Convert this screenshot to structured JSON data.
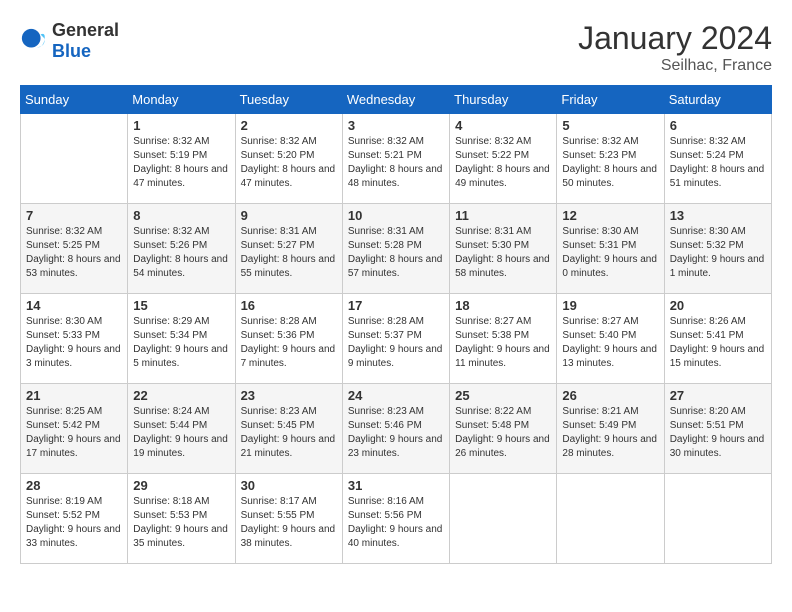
{
  "header": {
    "logo_general": "General",
    "logo_blue": "Blue",
    "month": "January 2024",
    "location": "Seilhac, France"
  },
  "days_of_week": [
    "Sunday",
    "Monday",
    "Tuesday",
    "Wednesday",
    "Thursday",
    "Friday",
    "Saturday"
  ],
  "weeks": [
    [
      {
        "day": "",
        "sunrise": "",
        "sunset": "",
        "daylight": ""
      },
      {
        "day": "1",
        "sunrise": "Sunrise: 8:32 AM",
        "sunset": "Sunset: 5:19 PM",
        "daylight": "Daylight: 8 hours and 47 minutes."
      },
      {
        "day": "2",
        "sunrise": "Sunrise: 8:32 AM",
        "sunset": "Sunset: 5:20 PM",
        "daylight": "Daylight: 8 hours and 47 minutes."
      },
      {
        "day": "3",
        "sunrise": "Sunrise: 8:32 AM",
        "sunset": "Sunset: 5:21 PM",
        "daylight": "Daylight: 8 hours and 48 minutes."
      },
      {
        "day": "4",
        "sunrise": "Sunrise: 8:32 AM",
        "sunset": "Sunset: 5:22 PM",
        "daylight": "Daylight: 8 hours and 49 minutes."
      },
      {
        "day": "5",
        "sunrise": "Sunrise: 8:32 AM",
        "sunset": "Sunset: 5:23 PM",
        "daylight": "Daylight: 8 hours and 50 minutes."
      },
      {
        "day": "6",
        "sunrise": "Sunrise: 8:32 AM",
        "sunset": "Sunset: 5:24 PM",
        "daylight": "Daylight: 8 hours and 51 minutes."
      }
    ],
    [
      {
        "day": "7",
        "sunrise": "Sunrise: 8:32 AM",
        "sunset": "Sunset: 5:25 PM",
        "daylight": "Daylight: 8 hours and 53 minutes."
      },
      {
        "day": "8",
        "sunrise": "Sunrise: 8:32 AM",
        "sunset": "Sunset: 5:26 PM",
        "daylight": "Daylight: 8 hours and 54 minutes."
      },
      {
        "day": "9",
        "sunrise": "Sunrise: 8:31 AM",
        "sunset": "Sunset: 5:27 PM",
        "daylight": "Daylight: 8 hours and 55 minutes."
      },
      {
        "day": "10",
        "sunrise": "Sunrise: 8:31 AM",
        "sunset": "Sunset: 5:28 PM",
        "daylight": "Daylight: 8 hours and 57 minutes."
      },
      {
        "day": "11",
        "sunrise": "Sunrise: 8:31 AM",
        "sunset": "Sunset: 5:30 PM",
        "daylight": "Daylight: 8 hours and 58 minutes."
      },
      {
        "day": "12",
        "sunrise": "Sunrise: 8:30 AM",
        "sunset": "Sunset: 5:31 PM",
        "daylight": "Daylight: 9 hours and 0 minutes."
      },
      {
        "day": "13",
        "sunrise": "Sunrise: 8:30 AM",
        "sunset": "Sunset: 5:32 PM",
        "daylight": "Daylight: 9 hours and 1 minute."
      }
    ],
    [
      {
        "day": "14",
        "sunrise": "Sunrise: 8:30 AM",
        "sunset": "Sunset: 5:33 PM",
        "daylight": "Daylight: 9 hours and 3 minutes."
      },
      {
        "day": "15",
        "sunrise": "Sunrise: 8:29 AM",
        "sunset": "Sunset: 5:34 PM",
        "daylight": "Daylight: 9 hours and 5 minutes."
      },
      {
        "day": "16",
        "sunrise": "Sunrise: 8:28 AM",
        "sunset": "Sunset: 5:36 PM",
        "daylight": "Daylight: 9 hours and 7 minutes."
      },
      {
        "day": "17",
        "sunrise": "Sunrise: 8:28 AM",
        "sunset": "Sunset: 5:37 PM",
        "daylight": "Daylight: 9 hours and 9 minutes."
      },
      {
        "day": "18",
        "sunrise": "Sunrise: 8:27 AM",
        "sunset": "Sunset: 5:38 PM",
        "daylight": "Daylight: 9 hours and 11 minutes."
      },
      {
        "day": "19",
        "sunrise": "Sunrise: 8:27 AM",
        "sunset": "Sunset: 5:40 PM",
        "daylight": "Daylight: 9 hours and 13 minutes."
      },
      {
        "day": "20",
        "sunrise": "Sunrise: 8:26 AM",
        "sunset": "Sunset: 5:41 PM",
        "daylight": "Daylight: 9 hours and 15 minutes."
      }
    ],
    [
      {
        "day": "21",
        "sunrise": "Sunrise: 8:25 AM",
        "sunset": "Sunset: 5:42 PM",
        "daylight": "Daylight: 9 hours and 17 minutes."
      },
      {
        "day": "22",
        "sunrise": "Sunrise: 8:24 AM",
        "sunset": "Sunset: 5:44 PM",
        "daylight": "Daylight: 9 hours and 19 minutes."
      },
      {
        "day": "23",
        "sunrise": "Sunrise: 8:23 AM",
        "sunset": "Sunset: 5:45 PM",
        "daylight": "Daylight: 9 hours and 21 minutes."
      },
      {
        "day": "24",
        "sunrise": "Sunrise: 8:23 AM",
        "sunset": "Sunset: 5:46 PM",
        "daylight": "Daylight: 9 hours and 23 minutes."
      },
      {
        "day": "25",
        "sunrise": "Sunrise: 8:22 AM",
        "sunset": "Sunset: 5:48 PM",
        "daylight": "Daylight: 9 hours and 26 minutes."
      },
      {
        "day": "26",
        "sunrise": "Sunrise: 8:21 AM",
        "sunset": "Sunset: 5:49 PM",
        "daylight": "Daylight: 9 hours and 28 minutes."
      },
      {
        "day": "27",
        "sunrise": "Sunrise: 8:20 AM",
        "sunset": "Sunset: 5:51 PM",
        "daylight": "Daylight: 9 hours and 30 minutes."
      }
    ],
    [
      {
        "day": "28",
        "sunrise": "Sunrise: 8:19 AM",
        "sunset": "Sunset: 5:52 PM",
        "daylight": "Daylight: 9 hours and 33 minutes."
      },
      {
        "day": "29",
        "sunrise": "Sunrise: 8:18 AM",
        "sunset": "Sunset: 5:53 PM",
        "daylight": "Daylight: 9 hours and 35 minutes."
      },
      {
        "day": "30",
        "sunrise": "Sunrise: 8:17 AM",
        "sunset": "Sunset: 5:55 PM",
        "daylight": "Daylight: 9 hours and 38 minutes."
      },
      {
        "day": "31",
        "sunrise": "Sunrise: 8:16 AM",
        "sunset": "Sunset: 5:56 PM",
        "daylight": "Daylight: 9 hours and 40 minutes."
      },
      {
        "day": "",
        "sunrise": "",
        "sunset": "",
        "daylight": ""
      },
      {
        "day": "",
        "sunrise": "",
        "sunset": "",
        "daylight": ""
      },
      {
        "day": "",
        "sunrise": "",
        "sunset": "",
        "daylight": ""
      }
    ]
  ]
}
